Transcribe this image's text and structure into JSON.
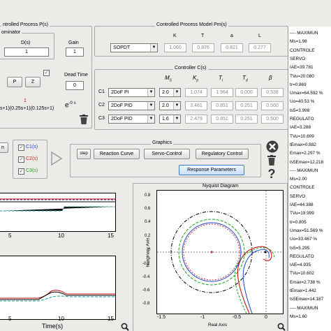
{
  "process": {
    "title": "ntrolled Process P(s)",
    "denominator_label": "ominator",
    "ds_label": "D(s)",
    "ds_value": "1",
    "gain_label": "Gain",
    "gain_value": "1",
    "dead_time_label": "Dead Time",
    "dead_time_value": "0",
    "red_one": "1",
    "poly": "s+1)(0.25s+1)(0.125s+1)",
    "exp_base": "e",
    "exp_sup": "-0 s",
    "p_button": "P",
    "z_button": "Z"
  },
  "model": {
    "title": "Controlled Process Model Pm(s)",
    "col_k": "K",
    "col_t": "T",
    "col_a": "a",
    "col_l": "L",
    "type_value": "SOPDT",
    "k": "1.060",
    "t": "0.876",
    "a": "0.821",
    "l": "0.277"
  },
  "controller": {
    "title": "Controller C(s)",
    "h_ms": "M",
    "h_ms_sub": "S",
    "h_kp": "K",
    "h_kp_sub": "p",
    "h_ti": "T",
    "h_ti_sub": "i",
    "h_td": "T",
    "h_td_sub": "d",
    "h_beta": "β",
    "rows": [
      {
        "label": "C1",
        "type": "2DoF PI",
        "ms": "2.0",
        "kp": "1.074",
        "ti": "1.964",
        "td": "0.000",
        "beta": "0.538"
      },
      {
        "label": "C2",
        "type": "2DoF PID",
        "ms": "2.0",
        "kp": "3.481",
        "ti": "0.851",
        "td": "0.251",
        "beta": "0.560"
      },
      {
        "label": "C3",
        "type": "2DoF PID",
        "ms": "1.6",
        "kp": "2.479",
        "ti": "0.851",
        "td": "0.251",
        "beta": "0.500"
      }
    ]
  },
  "graphics": {
    "title": "Graphics",
    "c1": "C1(s)",
    "c2": "C2(s)",
    "c3": "C3(s)",
    "step_button": "step",
    "reaction_button": "Reaction Curve",
    "servo_button": "Servo-Control",
    "regulatory_button": "Regulatory Control",
    "response_button": "Response Parameters",
    "left_tab": "n"
  },
  "colors": {
    "c1": "#1f3fd0",
    "c2": "#d01f1f",
    "c3": "#1fa01f",
    "accent": "#3a78c8"
  },
  "plots": {
    "x_ticks": [
      "5",
      "10",
      "15"
    ],
    "x_ticks2": [
      "5",
      "10",
      "15"
    ],
    "xlabel": "Time(s)",
    "nyquist_title": "Nyquist Diagram",
    "nyquist_xlabel": "Real Axis",
    "nyquist_ylabel": "Imaginary Axis",
    "ny_yticks": [
      "0.8",
      "0.6",
      "0.4",
      "0.2",
      "0",
      "-0.2",
      "-0.4",
      "-0.6",
      "-0.8"
    ],
    "ny_xticks": [
      "-1.5",
      "-1",
      "-0.5",
      "0"
    ]
  },
  "sidebar": {
    "lines": [
      {
        "t": "---- MAXIMUN",
        "y": 44
      },
      {
        "t": "Ms=1.98",
        "y": 55
      },
      {
        "t": "CONTROLE",
        "y": 72
      },
      {
        "t": "SERVO",
        "y": 88
      },
      {
        "t": "IAE=39.781",
        "y": 98
      },
      {
        "t": "TVu=20.080",
        "y": 106
      },
      {
        "t": "tr=0.869",
        "y": 114
      },
      {
        "t": "Umax=64.592 %",
        "y": 122
      },
      {
        "t": "Uo=40.53 %",
        "y": 130
      },
      {
        "t": "ts5=3.998",
        "y": 138
      },
      {
        "t": "REGULATO",
        "y": 155
      },
      {
        "t": "IAE=3.288",
        "y": 165
      },
      {
        "t": "TVu=10.609",
        "y": 173
      },
      {
        "t": "tEmax=0.882",
        "y": 181
      },
      {
        "t": "Emax=2.297 %",
        "y": 189
      },
      {
        "t": "ts5Emax=12.218",
        "y": 197
      },
      {
        "t": "---- MAXIMUN",
        "y": 227
      },
      {
        "t": "Ms=2.00",
        "y": 238
      },
      {
        "t": "CONTROLE",
        "y": 255
      },
      {
        "t": "SERVO",
        "y": 271
      },
      {
        "t": "IAE=44.388",
        "y": 281
      },
      {
        "t": "TVu=19.999",
        "y": 289
      },
      {
        "t": "tr=0.805",
        "y": 297
      },
      {
        "t": "Umax=51.569 %",
        "y": 305
      },
      {
        "t": "Uo=33.467 %",
        "y": 313
      },
      {
        "t": "ts5=5.295",
        "y": 321
      },
      {
        "t": "REGULATO",
        "y": 338
      },
      {
        "t": "IAE=4.935",
        "y": 348
      },
      {
        "t": "TVu=10.602",
        "y": 356
      },
      {
        "t": "Emax=2.738 %",
        "y": 364
      },
      {
        "t": "tEmax=1.442",
        "y": 372
      },
      {
        "t": "ts5Emax=14.187",
        "y": 380
      },
      {
        "t": "---- MAXIMUN",
        "y": 412
      },
      {
        "t": "Ms=1.60",
        "y": 423
      }
    ]
  }
}
